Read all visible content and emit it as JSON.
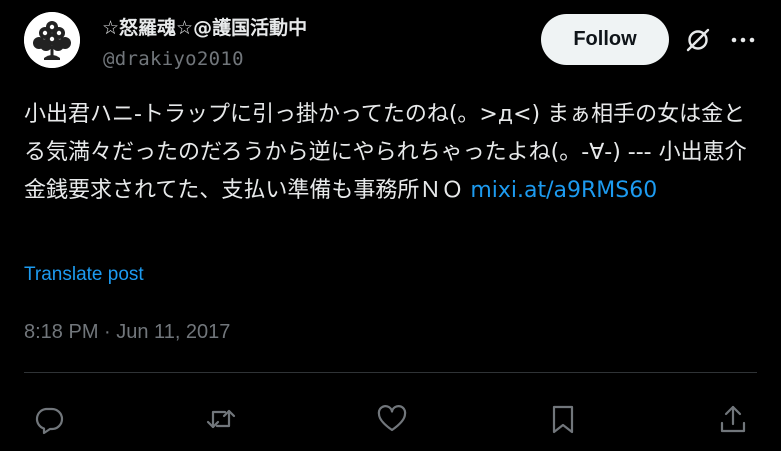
{
  "author": {
    "display_name": "☆怒羅魂☆@護国活動中",
    "handle": "@drakiyo2010",
    "avatar_icon": "crest-avatar-icon"
  },
  "header": {
    "follow_label": "Follow",
    "grok_icon": "grok-icon",
    "more_icon": "more-options-icon"
  },
  "tweet": {
    "text": "小出君ハニ-トラップに引っ掛かってたのね(。>д<) まぁ相手の女は金とる気満々だったのだろうから逆にやられちゃったよね(。-∀-) --- 小出恵介金銭要求されてた、支払い準備も事務所ＮＯ ",
    "link_text": "mixi.at/a9RMS60",
    "translate_label": "Translate post",
    "timestamp": "8:18 PM · Jun 11, 2017"
  },
  "actions": {
    "reply_icon": "reply-icon",
    "retweet_icon": "retweet-icon",
    "like_icon": "like-icon",
    "bookmark_icon": "bookmark-icon",
    "share_icon": "share-icon"
  },
  "colors": {
    "background": "#000000",
    "text_primary": "#e7e9ea",
    "text_secondary": "#71767b",
    "link": "#1d9bf0",
    "divider": "#2f3336",
    "button_bg": "#eff3f4"
  }
}
